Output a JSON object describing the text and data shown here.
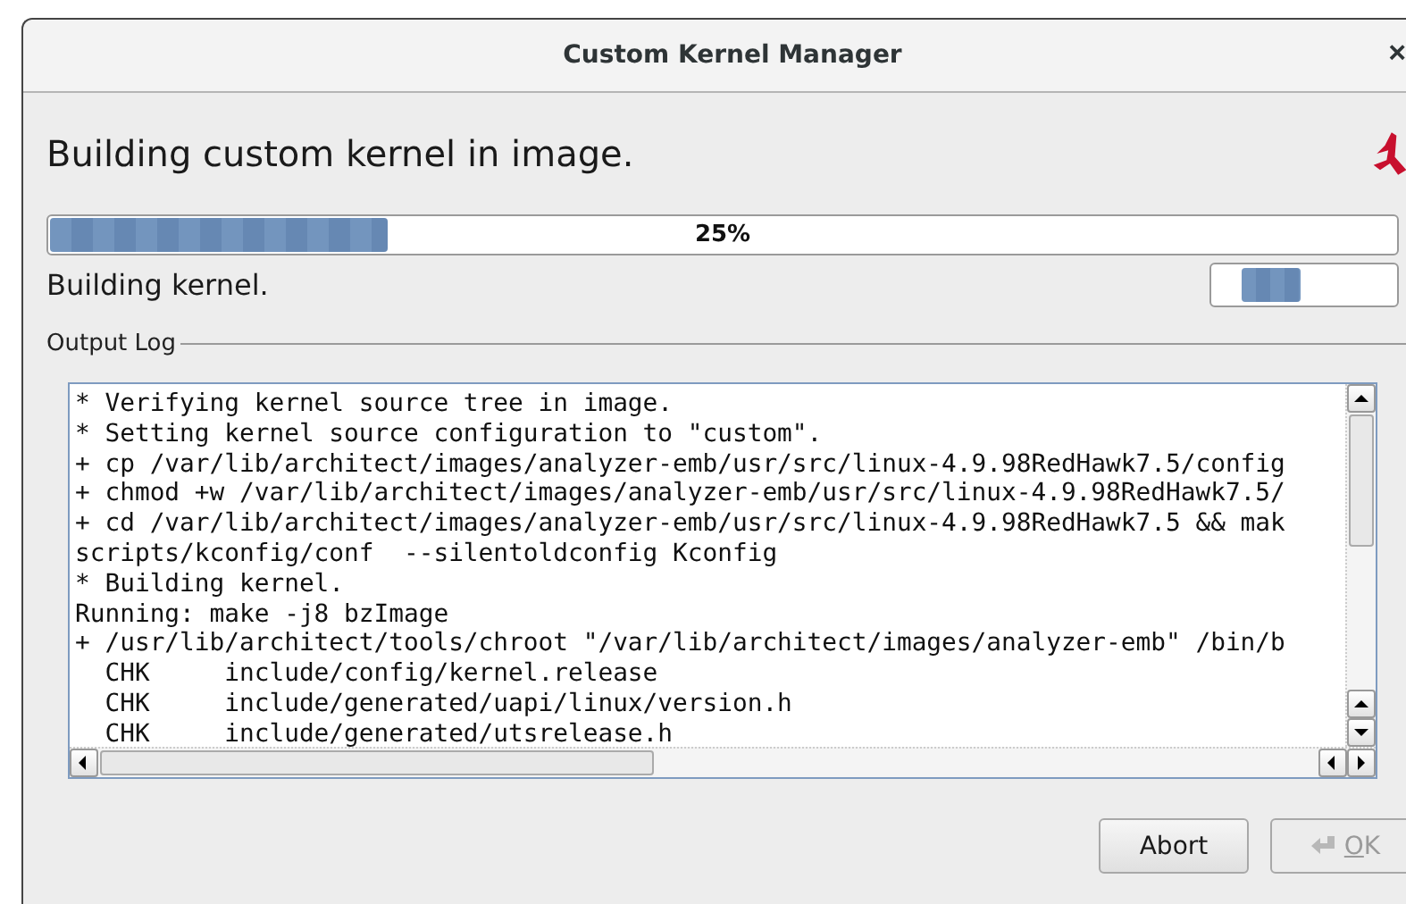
{
  "window": {
    "title": "Custom Kernel Manager",
    "close": "×"
  },
  "heading": "Building custom kernel in image.",
  "progress": {
    "level": 0.25,
    "label": "25%"
  },
  "status": "Building kernel.",
  "output_log": {
    "label": "Output Log",
    "lines": [
      "* Verifying kernel source tree in image.",
      "* Setting kernel source configuration to \"custom\".",
      "+ cp /var/lib/architect/images/analyzer-emb/usr/src/linux-4.9.98RedHawk7.5/config",
      "+ chmod +w /var/lib/architect/images/analyzer-emb/usr/src/linux-4.9.98RedHawk7.5/",
      "+ cd /var/lib/architect/images/analyzer-emb/usr/src/linux-4.9.98RedHawk7.5 && mak",
      "scripts/kconfig/conf  --silentoldconfig Kconfig",
      "* Building kernel.",
      "Running: make -j8 bzImage",
      "+ /usr/lib/architect/tools/chroot \"/var/lib/architect/images/analyzer-emb\" /bin/b",
      "  CHK     include/config/kernel.release",
      "  CHK     include/generated/uapi/linux/version.h",
      "  CHK     include/generated/utsrelease.h"
    ]
  },
  "buttons": [
    {
      "label": "Abort",
      "disabled": false,
      "kind": "plain"
    },
    {
      "label": "OK",
      "disabled": true,
      "kind": "ok"
    }
  ]
}
